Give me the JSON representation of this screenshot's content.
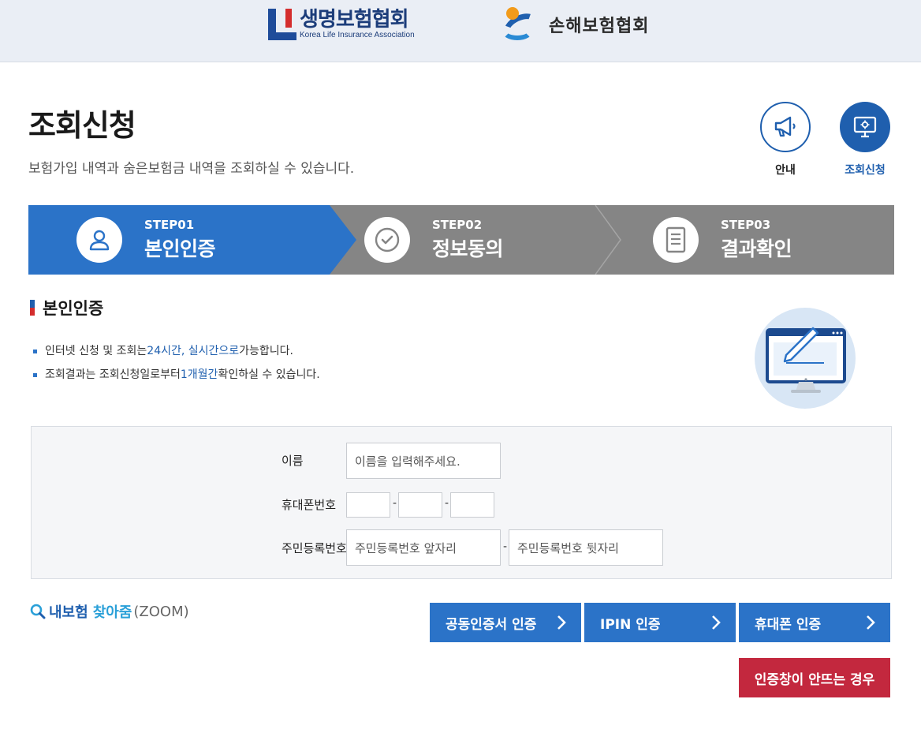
{
  "header": {
    "logo1_ko": "생명보험협회",
    "logo1_en": "Korea Life Insurance Association",
    "logo2_ko": "손해보험협회"
  },
  "page": {
    "title": "조회신청",
    "description": "보험가입 내역과 숨은보험금 내역을 조회하실 수 있습니다."
  },
  "side_buttons": {
    "guide_label": "안내",
    "query_label": "조회신청"
  },
  "steps": [
    {
      "num": "STEP01",
      "name": "본인인증",
      "icon": "user-icon",
      "active": true
    },
    {
      "num": "STEP02",
      "name": "정보동의",
      "icon": "check-circle-icon",
      "active": false
    },
    {
      "num": "STEP03",
      "name": "결과확인",
      "icon": "document-icon",
      "active": false
    }
  ],
  "section": {
    "title": "본인인증",
    "note1": {
      "pre": "인터넷 신청 및 조회는 ",
      "hl": "24시간, 실시간으로",
      "post": " 가능합니다."
    },
    "note2": {
      "pre": "조회결과는 조회신청일로부터 ",
      "hl": "1개월간",
      "post": " 확인하실 수 있습니다."
    }
  },
  "form": {
    "name_label": "이름",
    "name_placeholder": "이름을 입력해주세요.",
    "phone_label": "휴대폰번호",
    "phone_sep": "-",
    "rrn_label": "주민등록번호",
    "rrn_front_placeholder": "주민등록번호 앞자리",
    "rrn_back_placeholder": "주민등록번호 뒷자리"
  },
  "zoom": {
    "part1": "내보험",
    "part2": "찾아줌",
    "part3": "(ZOOM)"
  },
  "actions": {
    "cert_label": "공동인증서 인증",
    "ipin_label": "IPIN 인증",
    "phone_label": "휴대폰 인증",
    "help_label": "인증창이 안뜨는 경우"
  },
  "colors": {
    "primary": "#2b73c8",
    "step_inactive": "#858585",
    "danger": "#c3283e",
    "brand_navy": "#1f4c9a"
  }
}
